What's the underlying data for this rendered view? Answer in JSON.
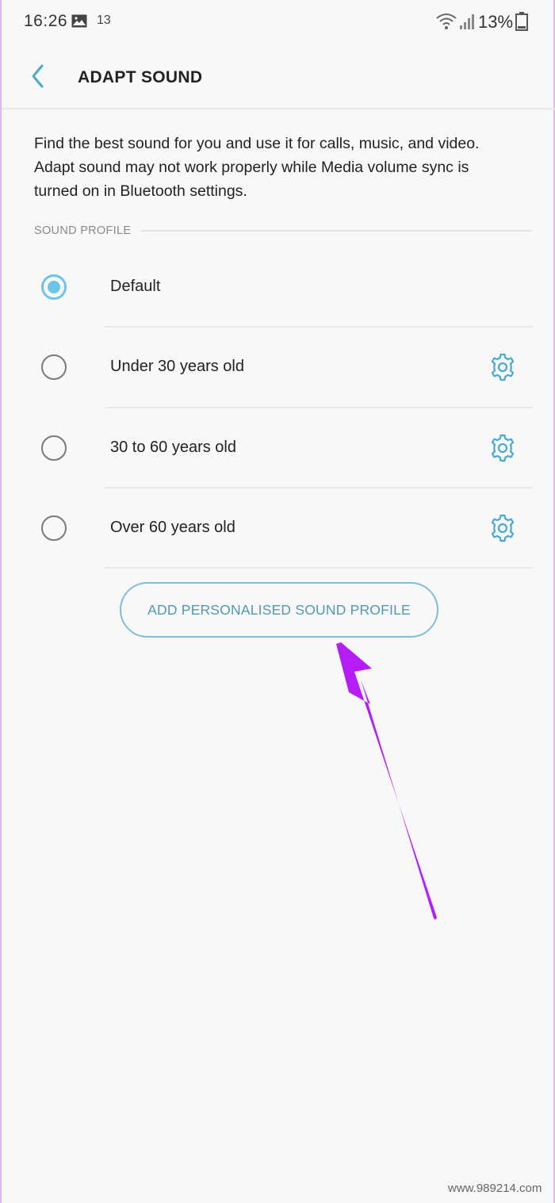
{
  "status_bar": {
    "time": "16:26",
    "notification_count": "13",
    "battery_percent": "13%",
    "icons": [
      "image-icon",
      "wifi-icon",
      "signal-icon",
      "battery-icon"
    ]
  },
  "header": {
    "title": "ADAPT SOUND",
    "back_icon": "chevron-left-icon"
  },
  "description": {
    "line1": "Find the best sound for you and use it for calls, music, and video.",
    "line2": "Adapt sound may not work properly while Media volume sync is",
    "line3": "turned on in Bluetooth settings."
  },
  "section": {
    "title": "SOUND PROFILE"
  },
  "options": [
    {
      "label": "Default",
      "selected": true,
      "has_settings": false
    },
    {
      "label": "Under 30 years old",
      "selected": false,
      "has_settings": true
    },
    {
      "label": "30 to 60 years old",
      "selected": false,
      "has_settings": true
    },
    {
      "label": "Over 60 years old",
      "selected": false,
      "has_settings": true
    }
  ],
  "add_button": {
    "label": "ADD PERSONALISED SOUND PROFILE"
  },
  "watermark": {
    "text": "www.989214.com"
  },
  "colors": {
    "accent": "#6cc4e8",
    "button_text": "#4e9ab8",
    "arrow": "#b61cf5",
    "background": "#f8f8f8"
  }
}
